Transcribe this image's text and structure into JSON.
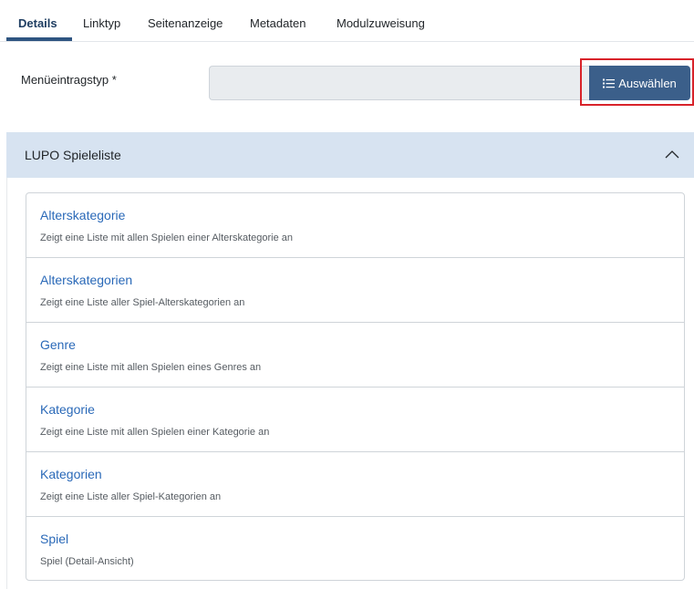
{
  "tabs": [
    {
      "label": "Details",
      "active": true
    },
    {
      "label": "Linktyp",
      "active": false
    },
    {
      "label": "Seitenanzeige",
      "active": false
    },
    {
      "label": "Metadaten",
      "active": false
    },
    {
      "label": "Modulzuweisung",
      "active": false
    }
  ],
  "field": {
    "label": "Menüeintragstyp *",
    "value": "",
    "button_label": "Auswählen",
    "button_icon": "list-icon"
  },
  "accordion": {
    "title": "LUPO Spieleliste",
    "expanded": true,
    "toggle_icon": "chevron-up-icon",
    "items": [
      {
        "title": "Alterskategorie",
        "description": "Zeigt eine Liste mit allen Spielen einer Alterskategorie an"
      },
      {
        "title": "Alterskategorien",
        "description": "Zeigt eine Liste aller Spiel-Alterskategorien an"
      },
      {
        "title": "Genre",
        "description": "Zeigt eine Liste mit allen Spielen eines Genres an"
      },
      {
        "title": "Kategorie",
        "description": "Zeigt eine Liste mit allen Spielen einer Kategorie an"
      },
      {
        "title": "Kategorien",
        "description": "Zeigt eine Liste aller Spiel-Kategorien an"
      },
      {
        "title": "Spiel",
        "description": "Spiel (Detail-Ansicht)"
      }
    ]
  },
  "colors": {
    "accent": "#3b5f8a",
    "link": "#2a69b8",
    "header_bg": "#d7e3f1",
    "highlight": "#d8232a"
  }
}
